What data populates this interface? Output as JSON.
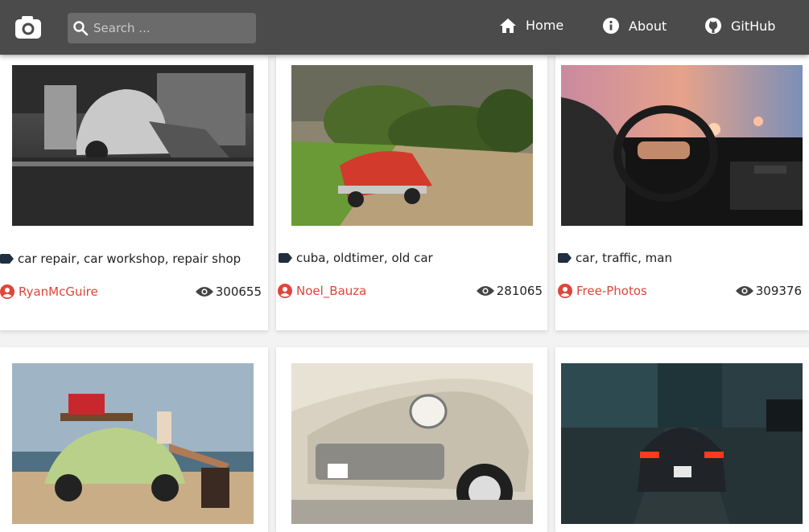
{
  "search": {
    "placeholder": "Search ..."
  },
  "nav": [
    {
      "label": "Home",
      "icon": "home-icon"
    },
    {
      "label": "About",
      "icon": "info-icon"
    },
    {
      "label": "GitHub",
      "icon": "github-icon"
    }
  ],
  "cards": [
    {
      "tags": "car repair, car workshop, repair shop",
      "user": "RyanMcGuire",
      "views": "300655"
    },
    {
      "tags": "cuba, oldtimer, old car",
      "user": "Noel_Bauza",
      "views": "281065"
    },
    {
      "tags": "car, traffic, man",
      "user": "Free-Photos",
      "views": "309376"
    },
    {
      "tags": "",
      "user": "",
      "views": ""
    },
    {
      "tags": "",
      "user": "",
      "views": ""
    },
    {
      "tags": "",
      "user": "",
      "views": ""
    }
  ],
  "colors": {
    "navbar": "#4b4b4b",
    "accent": "#e0453a"
  }
}
